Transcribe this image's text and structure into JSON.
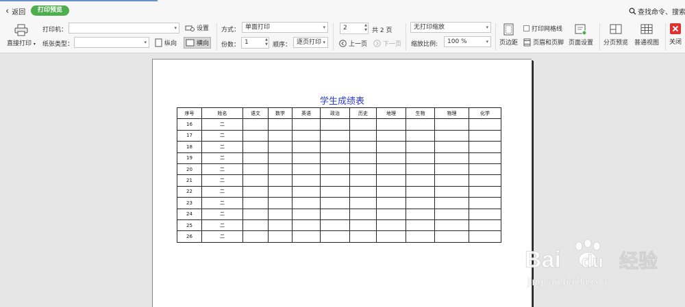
{
  "topbar": {
    "back_label": "返回",
    "mode_pill": "打印预览",
    "search_label": "查找命令、搜索模"
  },
  "ribbon": {
    "direct_print_label": "直接打印",
    "printer_label": "打印机：",
    "printer_value": "",
    "paper_type_label": "纸张类型：",
    "paper_type_value": "",
    "settings_label": "设置",
    "portrait_label": "纵向",
    "landscape_label": "横向",
    "mode_label": "方式：",
    "mode_value": "单面打印",
    "copies_label": "份数：",
    "copies_value": "1",
    "order_label": "顺序：",
    "order_value": "逐页打印",
    "page_value": "2",
    "page_total": "共 2 页",
    "prev_label": "上一页",
    "next_label": "下一页",
    "scale_mode_value": "无打印缩放",
    "scale_ratio_label": "缩放比例:",
    "scale_ratio_value": "100 %",
    "margins_label": "页边距",
    "gridlines_label": "打印网格线",
    "header_footer_label": "页眉和页脚",
    "page_setup_label": "页面设置",
    "page_break_label": "分页预览",
    "normal_view_label": "普通视图",
    "close_label": "关闭"
  },
  "sheet": {
    "title": "学生成绩表",
    "headers": [
      "序号",
      "姓名",
      "语文",
      "数学",
      "英语",
      "政治",
      "历史",
      "地理",
      "生物",
      "物理",
      "化学"
    ],
    "rows": [
      [
        "16",
        "二"
      ],
      [
        "17",
        "二"
      ],
      [
        "18",
        "二"
      ],
      [
        "19",
        "二"
      ],
      [
        "20",
        "二"
      ],
      [
        "21",
        "二"
      ],
      [
        "22",
        "二"
      ],
      [
        "23",
        "二"
      ],
      [
        "24",
        "二"
      ],
      [
        "25",
        "二"
      ],
      [
        "26",
        "二"
      ]
    ]
  },
  "watermark": {
    "brand": "Bai",
    "brand2": "du",
    "cn": "经验",
    "url": "jingyan.baidu.com"
  },
  "colors": {
    "accent_green": "#4cae4c",
    "title_blue": "#2a3bd6",
    "close_red": "#e03131"
  }
}
